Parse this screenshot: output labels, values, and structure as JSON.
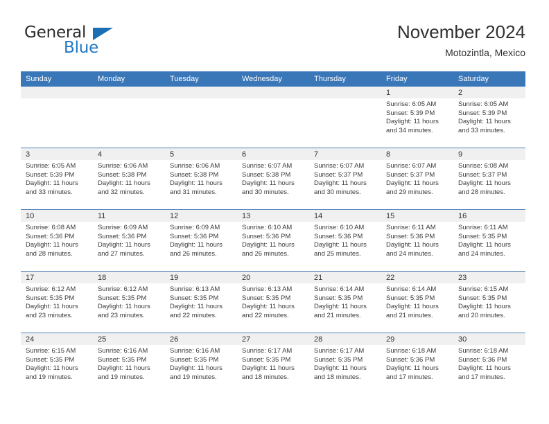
{
  "brand": {
    "name_top": "General",
    "name_bottom": "Blue",
    "accent_color": "#2077c4",
    "triangle_color": "#1b6fb5"
  },
  "header": {
    "title": "November 2024",
    "subtitle": "Motozintla, Mexico"
  },
  "theme": {
    "header_row_bg": "#3a77b8",
    "daynum_band_bg": "#f0f0f0",
    "grid_line": "#4a7fb5",
    "text": "#3a3a3a"
  },
  "weekdays": [
    "Sunday",
    "Monday",
    "Tuesday",
    "Wednesday",
    "Thursday",
    "Friday",
    "Saturday"
  ],
  "weeks": [
    [
      {
        "day": "",
        "empty": true
      },
      {
        "day": "",
        "empty": true
      },
      {
        "day": "",
        "empty": true
      },
      {
        "day": "",
        "empty": true
      },
      {
        "day": "",
        "empty": true
      },
      {
        "day": "1",
        "sunrise": "Sunrise: 6:05 AM",
        "sunset": "Sunset: 5:39 PM",
        "daylight": "Daylight: 11 hours and 34 minutes."
      },
      {
        "day": "2",
        "sunrise": "Sunrise: 6:05 AM",
        "sunset": "Sunset: 5:39 PM",
        "daylight": "Daylight: 11 hours and 33 minutes."
      }
    ],
    [
      {
        "day": "3",
        "sunrise": "Sunrise: 6:05 AM",
        "sunset": "Sunset: 5:39 PM",
        "daylight": "Daylight: 11 hours and 33 minutes."
      },
      {
        "day": "4",
        "sunrise": "Sunrise: 6:06 AM",
        "sunset": "Sunset: 5:38 PM",
        "daylight": "Daylight: 11 hours and 32 minutes."
      },
      {
        "day": "5",
        "sunrise": "Sunrise: 6:06 AM",
        "sunset": "Sunset: 5:38 PM",
        "daylight": "Daylight: 11 hours and 31 minutes."
      },
      {
        "day": "6",
        "sunrise": "Sunrise: 6:07 AM",
        "sunset": "Sunset: 5:38 PM",
        "daylight": "Daylight: 11 hours and 30 minutes."
      },
      {
        "day": "7",
        "sunrise": "Sunrise: 6:07 AM",
        "sunset": "Sunset: 5:37 PM",
        "daylight": "Daylight: 11 hours and 30 minutes."
      },
      {
        "day": "8",
        "sunrise": "Sunrise: 6:07 AM",
        "sunset": "Sunset: 5:37 PM",
        "daylight": "Daylight: 11 hours and 29 minutes."
      },
      {
        "day": "9",
        "sunrise": "Sunrise: 6:08 AM",
        "sunset": "Sunset: 5:37 PM",
        "daylight": "Daylight: 11 hours and 28 minutes."
      }
    ],
    [
      {
        "day": "10",
        "sunrise": "Sunrise: 6:08 AM",
        "sunset": "Sunset: 5:36 PM",
        "daylight": "Daylight: 11 hours and 28 minutes."
      },
      {
        "day": "11",
        "sunrise": "Sunrise: 6:09 AM",
        "sunset": "Sunset: 5:36 PM",
        "daylight": "Daylight: 11 hours and 27 minutes."
      },
      {
        "day": "12",
        "sunrise": "Sunrise: 6:09 AM",
        "sunset": "Sunset: 5:36 PM",
        "daylight": "Daylight: 11 hours and 26 minutes."
      },
      {
        "day": "13",
        "sunrise": "Sunrise: 6:10 AM",
        "sunset": "Sunset: 5:36 PM",
        "daylight": "Daylight: 11 hours and 26 minutes."
      },
      {
        "day": "14",
        "sunrise": "Sunrise: 6:10 AM",
        "sunset": "Sunset: 5:36 PM",
        "daylight": "Daylight: 11 hours and 25 minutes."
      },
      {
        "day": "15",
        "sunrise": "Sunrise: 6:11 AM",
        "sunset": "Sunset: 5:36 PM",
        "daylight": "Daylight: 11 hours and 24 minutes."
      },
      {
        "day": "16",
        "sunrise": "Sunrise: 6:11 AM",
        "sunset": "Sunset: 5:35 PM",
        "daylight": "Daylight: 11 hours and 24 minutes."
      }
    ],
    [
      {
        "day": "17",
        "sunrise": "Sunrise: 6:12 AM",
        "sunset": "Sunset: 5:35 PM",
        "daylight": "Daylight: 11 hours and 23 minutes."
      },
      {
        "day": "18",
        "sunrise": "Sunrise: 6:12 AM",
        "sunset": "Sunset: 5:35 PM",
        "daylight": "Daylight: 11 hours and 23 minutes."
      },
      {
        "day": "19",
        "sunrise": "Sunrise: 6:13 AM",
        "sunset": "Sunset: 5:35 PM",
        "daylight": "Daylight: 11 hours and 22 minutes."
      },
      {
        "day": "20",
        "sunrise": "Sunrise: 6:13 AM",
        "sunset": "Sunset: 5:35 PM",
        "daylight": "Daylight: 11 hours and 22 minutes."
      },
      {
        "day": "21",
        "sunrise": "Sunrise: 6:14 AM",
        "sunset": "Sunset: 5:35 PM",
        "daylight": "Daylight: 11 hours and 21 minutes."
      },
      {
        "day": "22",
        "sunrise": "Sunrise: 6:14 AM",
        "sunset": "Sunset: 5:35 PM",
        "daylight": "Daylight: 11 hours and 21 minutes."
      },
      {
        "day": "23",
        "sunrise": "Sunrise: 6:15 AM",
        "sunset": "Sunset: 5:35 PM",
        "daylight": "Daylight: 11 hours and 20 minutes."
      }
    ],
    [
      {
        "day": "24",
        "sunrise": "Sunrise: 6:15 AM",
        "sunset": "Sunset: 5:35 PM",
        "daylight": "Daylight: 11 hours and 19 minutes."
      },
      {
        "day": "25",
        "sunrise": "Sunrise: 6:16 AM",
        "sunset": "Sunset: 5:35 PM",
        "daylight": "Daylight: 11 hours and 19 minutes."
      },
      {
        "day": "26",
        "sunrise": "Sunrise: 6:16 AM",
        "sunset": "Sunset: 5:35 PM",
        "daylight": "Daylight: 11 hours and 19 minutes."
      },
      {
        "day": "27",
        "sunrise": "Sunrise: 6:17 AM",
        "sunset": "Sunset: 5:35 PM",
        "daylight": "Daylight: 11 hours and 18 minutes."
      },
      {
        "day": "28",
        "sunrise": "Sunrise: 6:17 AM",
        "sunset": "Sunset: 5:35 PM",
        "daylight": "Daylight: 11 hours and 18 minutes."
      },
      {
        "day": "29",
        "sunrise": "Sunrise: 6:18 AM",
        "sunset": "Sunset: 5:36 PM",
        "daylight": "Daylight: 11 hours and 17 minutes."
      },
      {
        "day": "30",
        "sunrise": "Sunrise: 6:18 AM",
        "sunset": "Sunset: 5:36 PM",
        "daylight": "Daylight: 11 hours and 17 minutes."
      }
    ]
  ]
}
